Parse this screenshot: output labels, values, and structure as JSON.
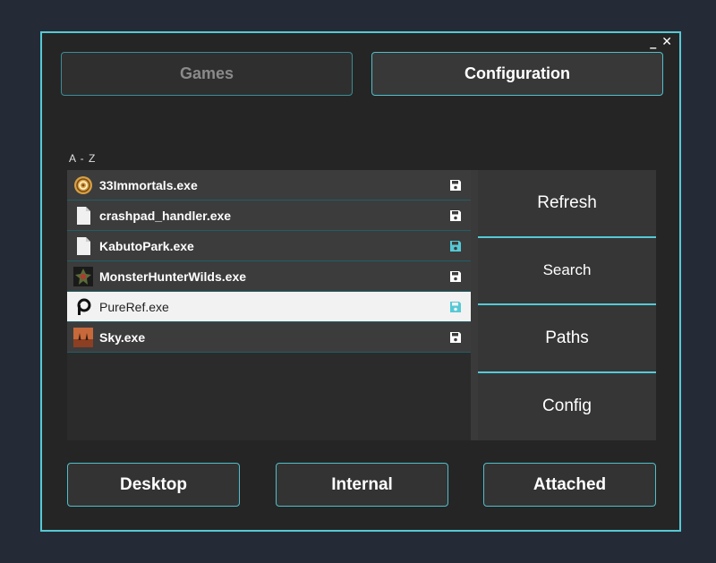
{
  "window": {
    "minimize_label": "_",
    "close_label": "✕"
  },
  "tabs": [
    {
      "label": "Games"
    },
    {
      "label": "Configuration"
    }
  ],
  "sort_label": "A - Z",
  "files": [
    {
      "name": "33Immortals.exe",
      "icon": "immortals-app-icon",
      "save_icon": "save-icon",
      "save_color": "#ffffff"
    },
    {
      "name": "crashpad_handler.exe",
      "icon": "blank-file-icon",
      "save_icon": "save-icon",
      "save_color": "#ffffff"
    },
    {
      "name": "KabutoPark.exe",
      "icon": "blank-file-icon",
      "save_icon": "save-icon",
      "save_color": "#55c9d6"
    },
    {
      "name": "MonsterHunterWilds.exe",
      "icon": "monster-hunter-app-icon",
      "save_icon": "save-icon",
      "save_color": "#ffffff"
    },
    {
      "name": "PureRef.exe",
      "icon": "pureref-app-icon",
      "save_icon": "save-icon",
      "save_color": "#55c9d6",
      "selected": true
    },
    {
      "name": "Sky.exe",
      "icon": "sky-app-icon",
      "save_icon": "save-icon",
      "save_color": "#ffffff"
    }
  ],
  "side_buttons": [
    {
      "label": "Refresh"
    },
    {
      "label": "Search"
    },
    {
      "label": "Paths"
    },
    {
      "label": "Config"
    }
  ],
  "bottom_buttons": [
    {
      "label": "Desktop"
    },
    {
      "label": "Internal"
    },
    {
      "label": "Attached"
    }
  ],
  "colors": {
    "accent": "#55c9d6",
    "background": "#252525",
    "selected_row": "#f2f2f2"
  }
}
